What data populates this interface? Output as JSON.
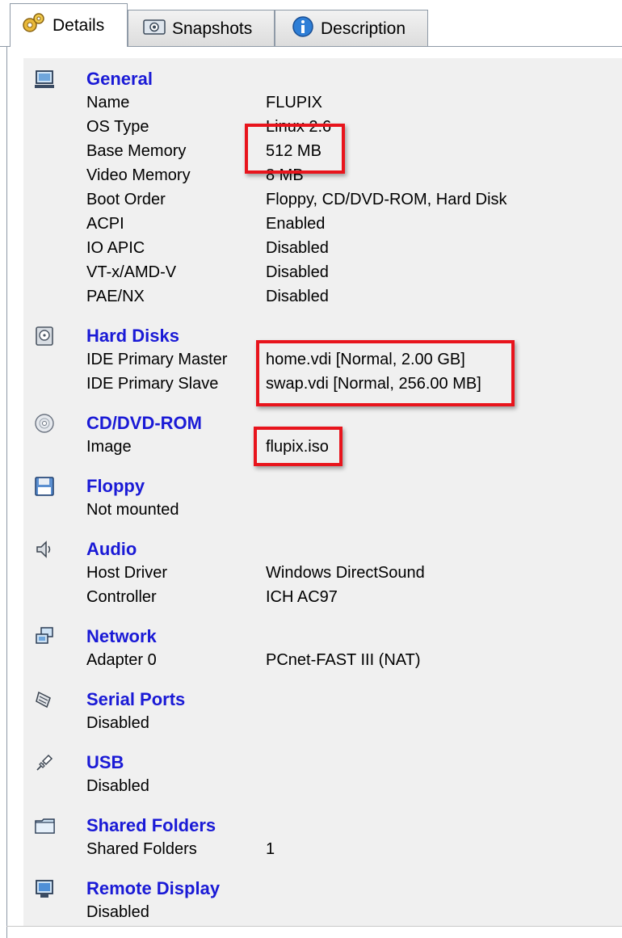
{
  "tabs": [
    {
      "label": "Details",
      "icon": "gear-icon",
      "active": true
    },
    {
      "label": "Snapshots",
      "icon": "camera-icon",
      "active": false
    },
    {
      "label": "Description",
      "icon": "info-icon",
      "active": false
    }
  ],
  "sections": {
    "general": {
      "title": "General",
      "rows": [
        {
          "key": "Name",
          "value": "FLUPIX"
        },
        {
          "key": "OS Type",
          "value": "Linux 2.6"
        },
        {
          "key": "Base Memory",
          "value": "512 MB"
        },
        {
          "key": "Video Memory",
          "value": "8 MB"
        },
        {
          "key": "Boot Order",
          "value": "Floppy, CD/DVD-ROM, Hard Disk"
        },
        {
          "key": "ACPI",
          "value": "Enabled"
        },
        {
          "key": "IO APIC",
          "value": "Disabled"
        },
        {
          "key": "VT-x/AMD-V",
          "value": "Disabled"
        },
        {
          "key": "PAE/NX",
          "value": "Disabled"
        }
      ]
    },
    "hard_disks": {
      "title": "Hard Disks",
      "rows": [
        {
          "key": "IDE Primary Master",
          "value": "home.vdi [Normal, 2.00 GB]"
        },
        {
          "key": "IDE Primary Slave",
          "value": "swap.vdi [Normal, 256.00 MB]"
        }
      ]
    },
    "cdrom": {
      "title": "CD/DVD-ROM",
      "rows": [
        {
          "key": "Image",
          "value": "flupix.iso"
        }
      ]
    },
    "floppy": {
      "title": "Floppy",
      "rows": [
        {
          "key": "Not mounted",
          "value": ""
        }
      ]
    },
    "audio": {
      "title": "Audio",
      "rows": [
        {
          "key": "Host Driver",
          "value": "Windows DirectSound"
        },
        {
          "key": "Controller",
          "value": "ICH AC97"
        }
      ]
    },
    "network": {
      "title": "Network",
      "rows": [
        {
          "key": "Adapter 0",
          "value": "PCnet-FAST III (NAT)"
        }
      ]
    },
    "serial": {
      "title": "Serial Ports",
      "rows": [
        {
          "key": "Disabled",
          "value": ""
        }
      ]
    },
    "usb": {
      "title": "USB",
      "rows": [
        {
          "key": "Disabled",
          "value": ""
        }
      ]
    },
    "shared_folders": {
      "title": "Shared Folders",
      "rows": [
        {
          "key": "Shared Folders",
          "value": "1"
        }
      ]
    },
    "remote_display": {
      "title": "Remote Display",
      "rows": [
        {
          "key": "Disabled",
          "value": ""
        }
      ]
    }
  },
  "colors": {
    "section_title": "#1a1ad6",
    "highlight": "#e8141c",
    "panel_bg": "#f0f0f0"
  }
}
